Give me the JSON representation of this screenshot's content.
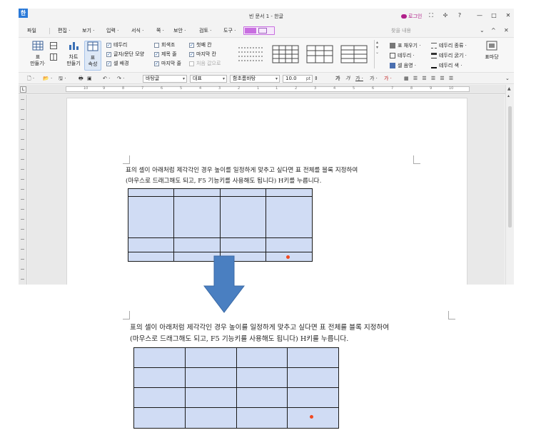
{
  "window": {
    "app_logo": "한",
    "title": "빈 문서 1 - 한글",
    "login_label": "로그인",
    "controls": [
      "⛶",
      "✢",
      "?",
      "—",
      "□",
      "✕"
    ]
  },
  "menu": {
    "items": [
      "파일",
      "편집 ·",
      "보기 ·",
      "입력 ·",
      "서식 ·",
      "쪽 ·",
      "보안 ·",
      "검토 ·",
      "도구 ·"
    ],
    "search_placeholder": "찾을 내용",
    "right_icons": [
      "⌄",
      "^",
      "✕"
    ]
  },
  "ribbon": {
    "make_table": "표\n만들기·",
    "make_chart": "차트\n만들기",
    "table_props": "표\n속성",
    "checks": [
      {
        "label": "테두리",
        "checked": true
      },
      {
        "label": "글자/문단 모양",
        "checked": true
      },
      {
        "label": "셀 배경",
        "checked": true
      },
      {
        "label": "회색조",
        "checked": false
      },
      {
        "label": "제목 줄",
        "checked": true
      },
      {
        "label": "마지막 줄",
        "checked": true
      },
      {
        "label": "첫째 칸",
        "checked": true
      },
      {
        "label": "마지막 칸",
        "checked": true
      },
      {
        "label": "처음 값으로",
        "checked": false
      }
    ],
    "fill_label": "표 채우기 ·",
    "border_label": "테두리 ·",
    "cell_color_label": "셀 음영 ·",
    "border_type_label": "테두리 종류 ·",
    "border_width_label": "테두리 굵기 ·",
    "border_color_label": "테두리 색 ·",
    "table_border_label": "표마당"
  },
  "toolbar": {
    "style_value": "바탕글",
    "lang_value": "대표",
    "font_value": "함초롬바탕",
    "size_value": "10.0",
    "unit": "pt",
    "format_glyphs": [
      "가",
      "가",
      "가 ·",
      "가 ·",
      "가 ·"
    ]
  },
  "ruler": {
    "numbers": [
      "10",
      "9",
      "8",
      "7",
      "6",
      "5",
      "4",
      "3",
      "2",
      "1",
      "1",
      "2",
      "3",
      "4",
      "5",
      "6",
      "7",
      "8",
      "9",
      "10"
    ]
  },
  "document": {
    "line1": "표의 셀이 아래처럼 제각각인 경우 높이를 일정하게 맞추고 싶다면 표 전체를 블록 지정하여",
    "line2": "(마우스로 드래그해도 되고, F5 기능키를 사용해도 됩니다) H키를 누릅니다."
  },
  "after": {
    "line1": "표의 셀이 아래처럼 제각각인 경우 높이를 일정하게 맞추고 싶다면 표 전체를 블록 지정하여",
    "line2": "(마우스로 드래그해도 되고, F5 기능키를 사용해도 됩니다) H키를 누릅니다."
  },
  "colors": {
    "cell_fill": "#d0dcf4",
    "arrow_fill": "#4a7fc1",
    "cursor_dot": "#f04a22",
    "accent": "#b0208a"
  }
}
